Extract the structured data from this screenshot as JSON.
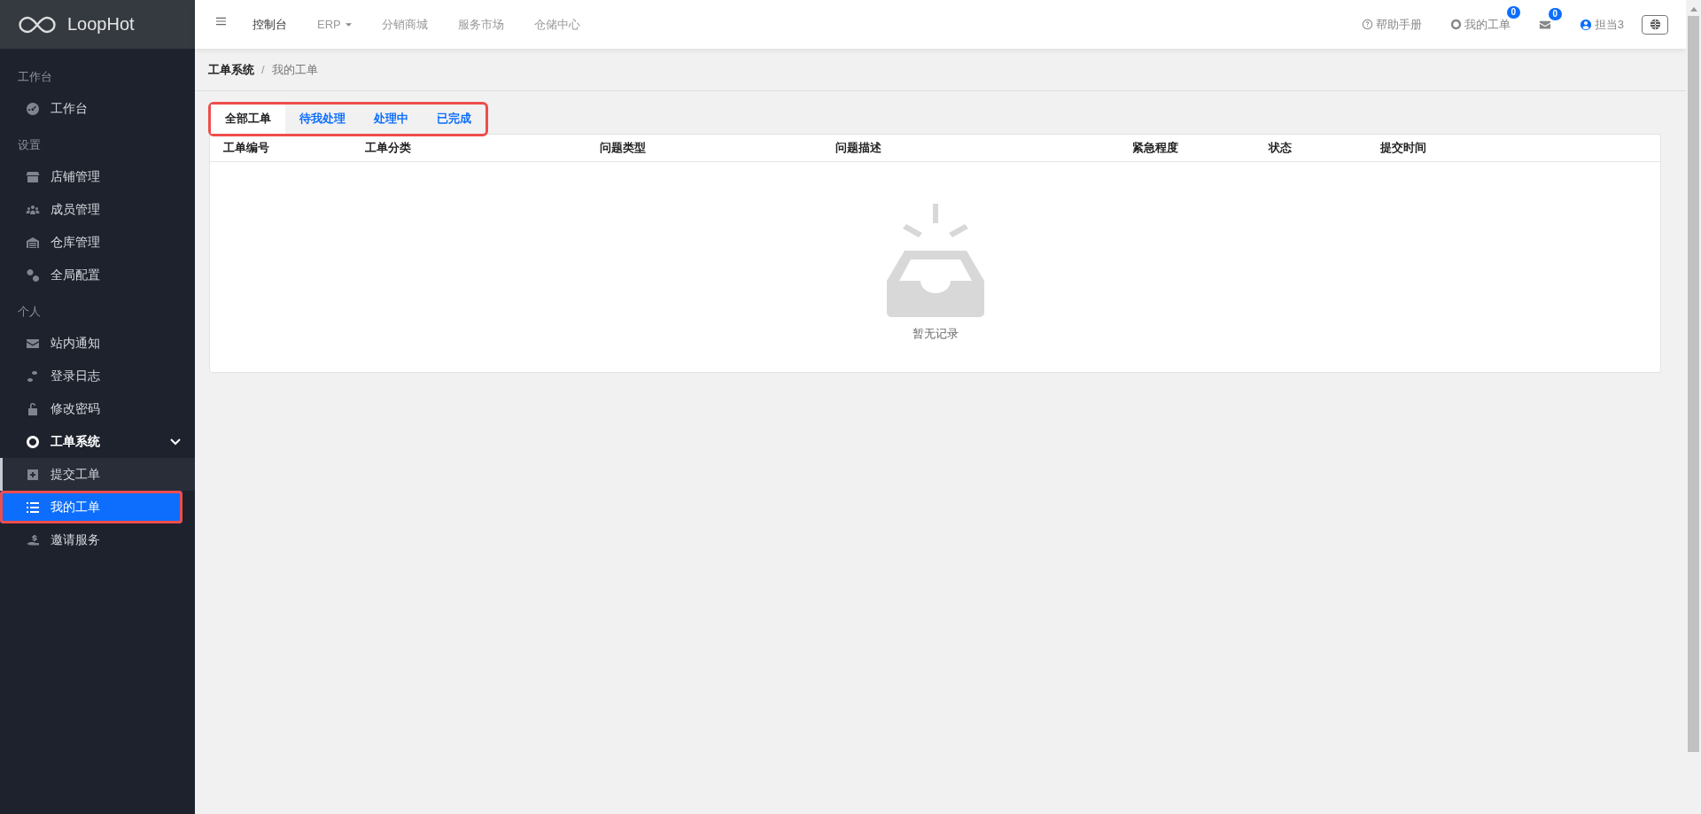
{
  "brand": {
    "name": "LoopHot"
  },
  "sidebar": {
    "sections": [
      {
        "heading": "工作台",
        "items": [
          {
            "label": "工作台",
            "selected": false
          }
        ]
      },
      {
        "heading": "设置",
        "items": [
          {
            "label": "店铺管理",
            "selected": false
          },
          {
            "label": "成员管理",
            "selected": false
          },
          {
            "label": "仓库管理",
            "selected": false
          },
          {
            "label": "全局配置",
            "selected": false
          }
        ]
      },
      {
        "heading": "个人",
        "items": [
          {
            "label": "站内通知",
            "selected": false
          },
          {
            "label": "登录日志",
            "selected": false
          },
          {
            "label": "修改密码",
            "selected": false
          },
          {
            "label": "工单系统",
            "selected": false,
            "expanded": true,
            "children": [
              {
                "label": "提交工单",
                "selected": false
              },
              {
                "label": "我的工单",
                "selected": true
              }
            ]
          },
          {
            "label": "邀请服务",
            "selected": false
          }
        ]
      }
    ]
  },
  "topbar": {
    "nav": [
      {
        "label": "控制台",
        "selected": true,
        "has_dropdown": false
      },
      {
        "label": "ERP",
        "selected": false,
        "has_dropdown": true
      },
      {
        "label": "分销商城",
        "selected": false,
        "has_dropdown": false
      },
      {
        "label": "服务市场",
        "selected": false,
        "has_dropdown": false
      },
      {
        "label": "仓储中心",
        "selected": false,
        "has_dropdown": false
      }
    ],
    "help": "帮助手册",
    "tickets": {
      "label": "我的工单",
      "badge": "0"
    },
    "messages": {
      "badge": "0"
    },
    "user": "担当3"
  },
  "breadcrumb_separator": "/",
  "breadcrumb": [
    {
      "label": "工单系统"
    },
    {
      "label": "我的工单"
    }
  ],
  "tabs": [
    {
      "label": "全部工单",
      "selected": true
    },
    {
      "label": "待我处理",
      "selected": false
    },
    {
      "label": "处理中",
      "selected": false
    },
    {
      "label": "已完成",
      "selected": false
    }
  ],
  "table": {
    "columns": [
      "工单编号",
      "工单分类",
      "问题类型",
      "问题描述",
      "紧急程度",
      "状态",
      "提交时间"
    ],
    "empty_text": "暂无记录"
  }
}
